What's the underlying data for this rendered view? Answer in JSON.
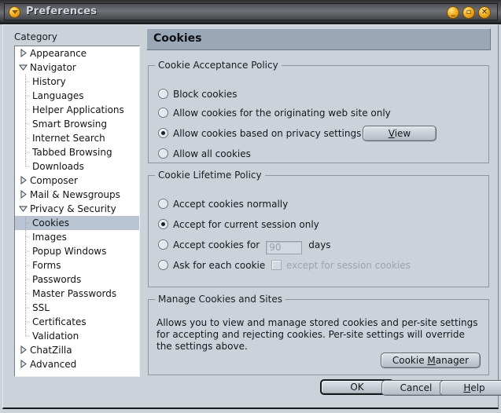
{
  "window": {
    "title": "Preferences",
    "icon": "window-menu-icon",
    "buttons": [
      {
        "name": "minimize-button",
        "glyph": "_"
      },
      {
        "name": "maximize-button",
        "glyph": "▫"
      },
      {
        "name": "close-button",
        "glyph": "✕"
      }
    ]
  },
  "sidebar": {
    "label": "Category",
    "selected": "Cookies",
    "items": [
      {
        "label": "Appearance",
        "level": 0,
        "state": "collapsed"
      },
      {
        "label": "Navigator",
        "level": 0,
        "state": "expanded"
      },
      {
        "label": "History",
        "level": 1,
        "state": "leaf"
      },
      {
        "label": "Languages",
        "level": 1,
        "state": "leaf"
      },
      {
        "label": "Helper Applications",
        "level": 1,
        "state": "leaf"
      },
      {
        "label": "Smart Browsing",
        "level": 1,
        "state": "leaf"
      },
      {
        "label": "Internet Search",
        "level": 1,
        "state": "leaf"
      },
      {
        "label": "Tabbed Browsing",
        "level": 1,
        "state": "leaf"
      },
      {
        "label": "Downloads",
        "level": 1,
        "state": "leaf",
        "last": true
      },
      {
        "label": "Composer",
        "level": 0,
        "state": "collapsed"
      },
      {
        "label": "Mail & Newsgroups",
        "level": 0,
        "state": "collapsed"
      },
      {
        "label": "Privacy & Security",
        "level": 0,
        "state": "expanded"
      },
      {
        "label": "Cookies",
        "level": 1,
        "state": "leaf",
        "selected": true
      },
      {
        "label": "Images",
        "level": 1,
        "state": "leaf"
      },
      {
        "label": "Popup Windows",
        "level": 1,
        "state": "leaf"
      },
      {
        "label": "Forms",
        "level": 1,
        "state": "leaf"
      },
      {
        "label": "Passwords",
        "level": 1,
        "state": "leaf"
      },
      {
        "label": "Master Passwords",
        "level": 1,
        "state": "leaf"
      },
      {
        "label": "SSL",
        "level": 1,
        "state": "leaf"
      },
      {
        "label": "Certificates",
        "level": 1,
        "state": "leaf"
      },
      {
        "label": "Validation",
        "level": 1,
        "state": "leaf",
        "last": true
      },
      {
        "label": "ChatZilla",
        "level": 0,
        "state": "collapsed"
      },
      {
        "label": "Advanced",
        "level": 0,
        "state": "collapsed"
      }
    ]
  },
  "page": {
    "title": "Cookies",
    "acceptance": {
      "legend": "Cookie Acceptance Policy",
      "options": [
        {
          "label": "Block cookies",
          "selected": false
        },
        {
          "label": "Allow cookies for the originating web site only",
          "selected": false
        },
        {
          "label": "Allow cookies based on privacy settings",
          "selected": true
        },
        {
          "label": "Allow all cookies",
          "selected": false
        }
      ],
      "view_button": {
        "label": "View",
        "accesskey": "V"
      }
    },
    "lifetime": {
      "legend": "Cookie Lifetime Policy",
      "options": [
        {
          "label": "Accept cookies normally",
          "selected": false
        },
        {
          "label": "Accept for current session only",
          "selected": true
        },
        {
          "label": "Accept cookies for",
          "selected": false
        },
        {
          "label": "Ask for each cookie",
          "selected": false
        }
      ],
      "days_value": "90",
      "days_suffix": "days",
      "session_checkbox": {
        "label": "except for session cookies",
        "checked": false,
        "disabled": true
      }
    },
    "manage": {
      "legend": "Manage Cookies and Sites",
      "description": "Allows you to view and manage stored cookies and per-site settings for accepting and rejecting cookies. Per-site settings will override the settings above.",
      "button": {
        "label": "Cookie Manager",
        "accesskey": "M"
      }
    }
  },
  "footer": {
    "ok": {
      "label": "OK",
      "default": true
    },
    "cancel": {
      "label": "Cancel"
    },
    "help": {
      "label": "Help",
      "accesskey": "H"
    }
  },
  "colors": {
    "dialog_bg": "#ccd2da",
    "header_bg": "#99a7b7",
    "selection_bg": "#b9c4d2",
    "accent_gold": "#f3ae20",
    "disabled_text": "#9aa3ac"
  }
}
